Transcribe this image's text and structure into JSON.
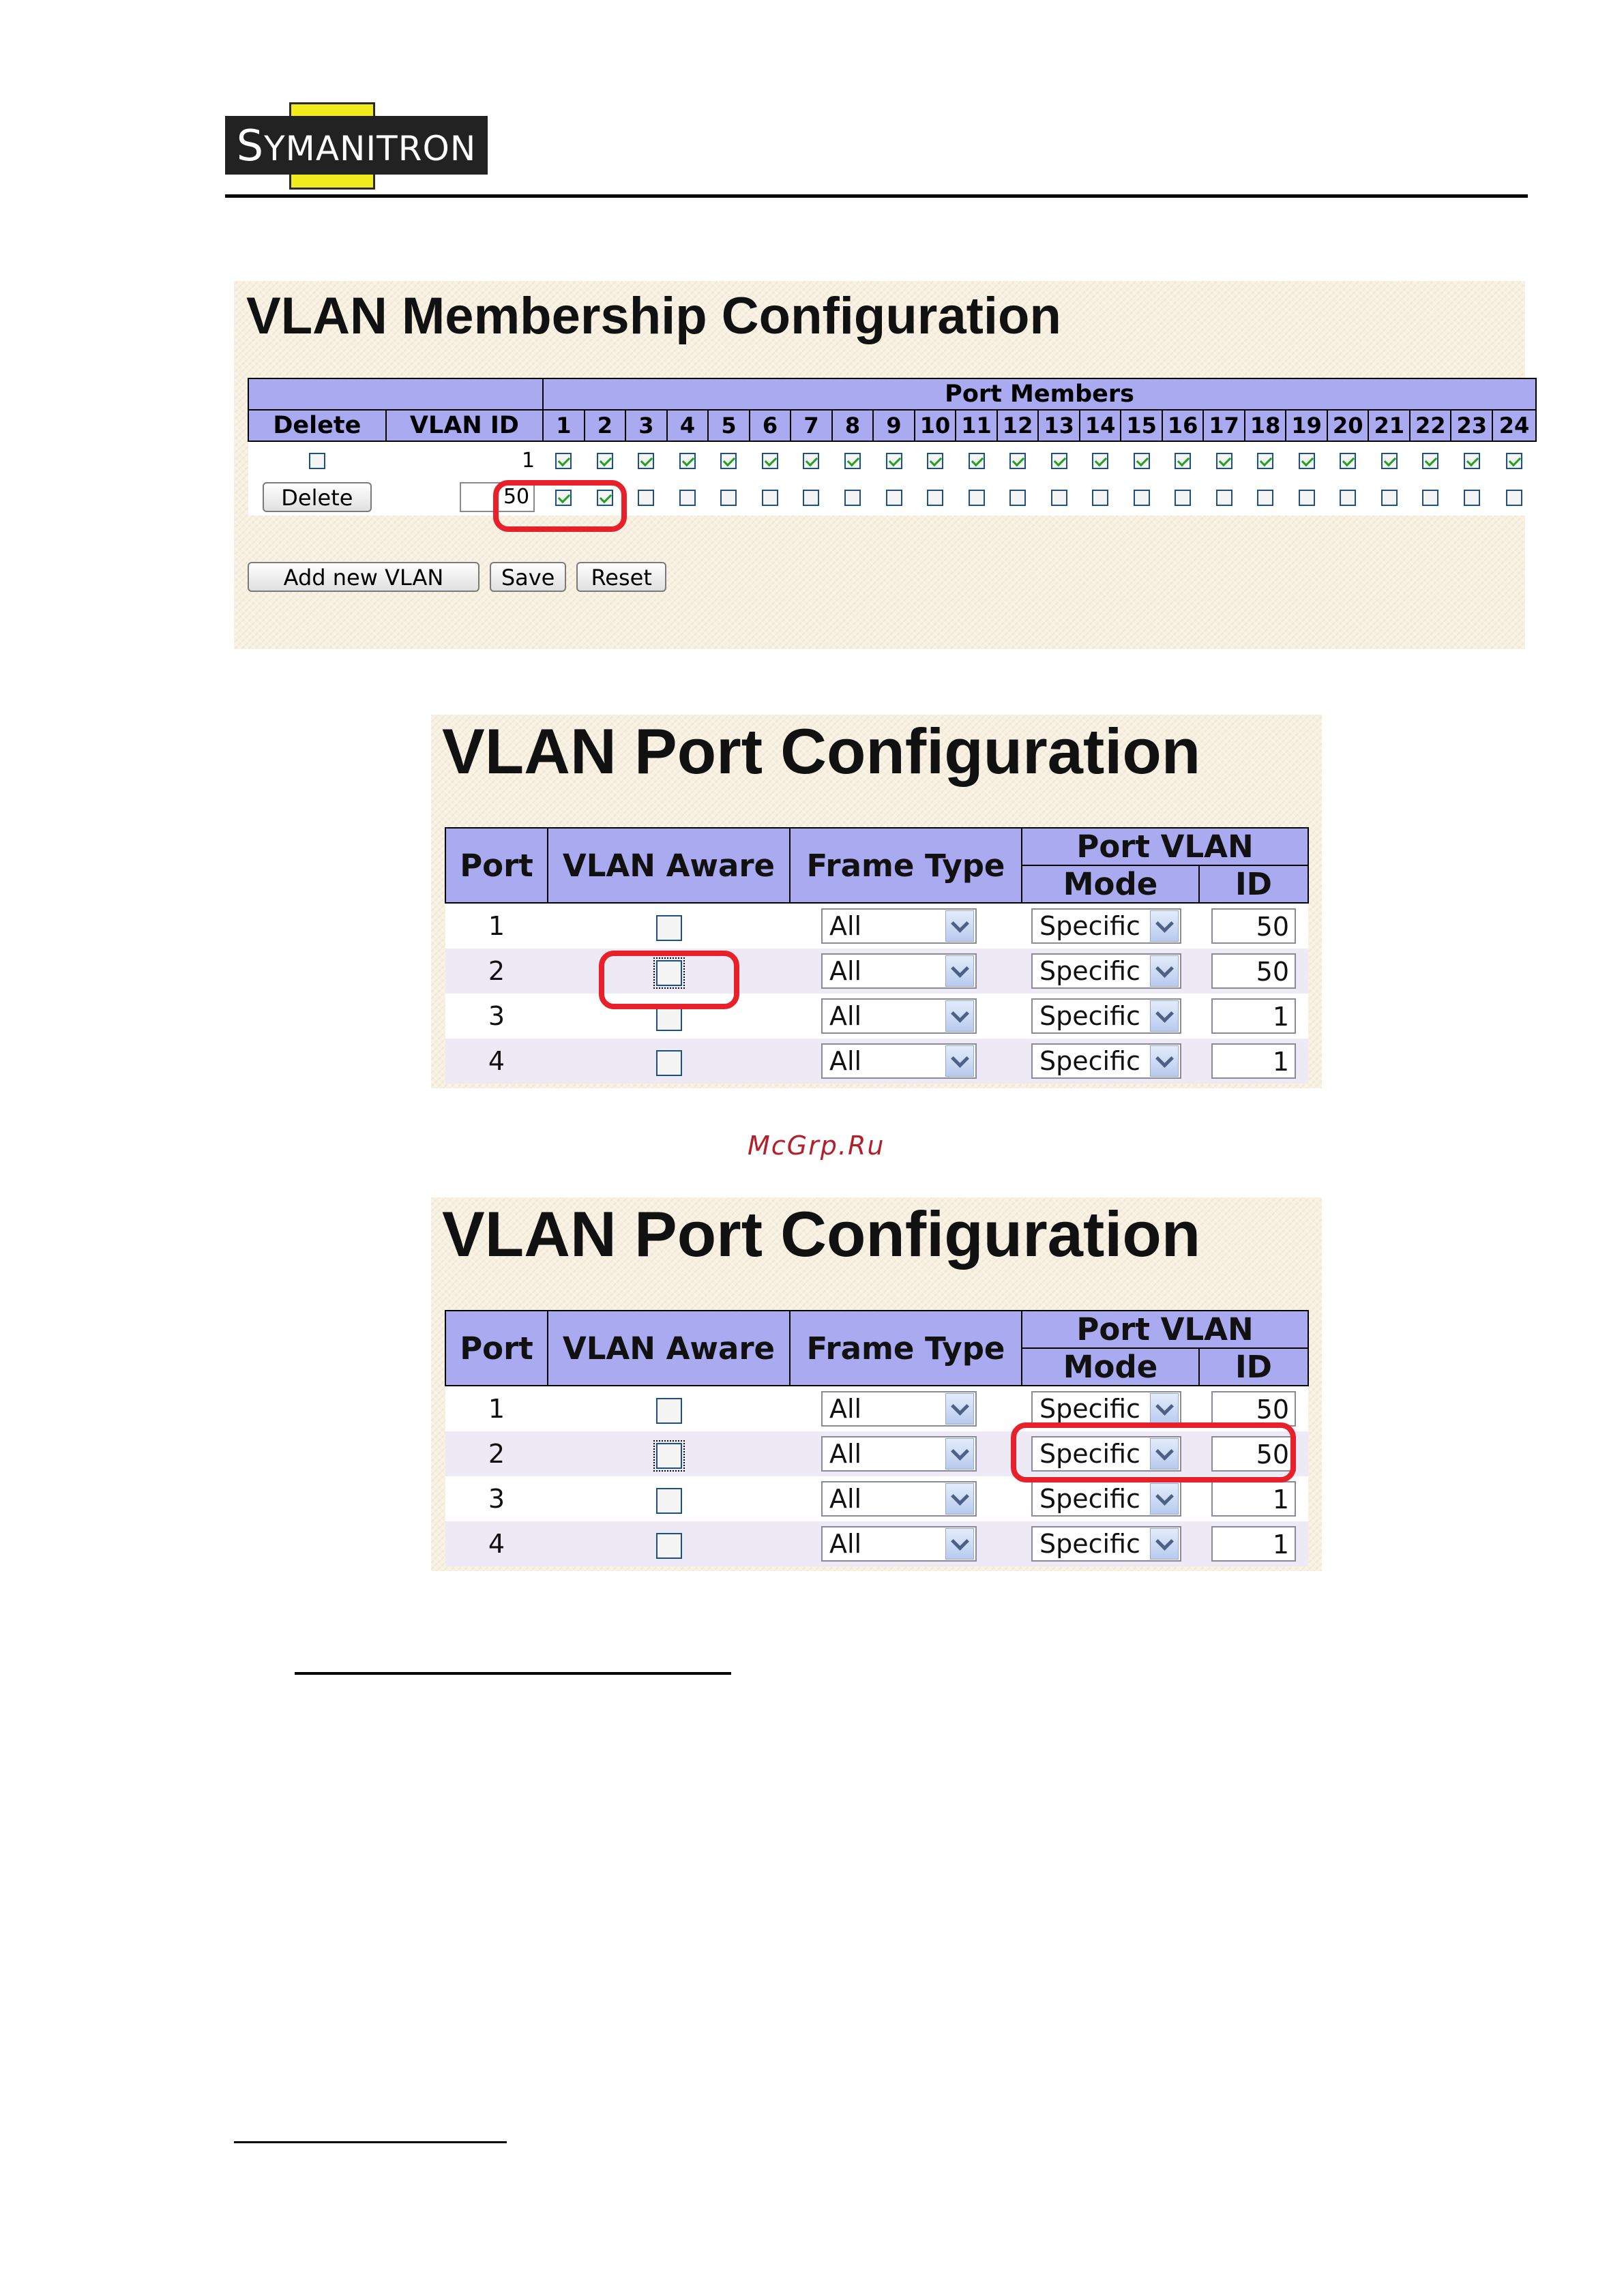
{
  "brand": {
    "logo_text": "SYMANITRON",
    "logo_initial": "S",
    "logo_rest": "YMANITRON"
  },
  "watermark": "McGrp.Ru",
  "membership": {
    "title": "VLAN Membership Configuration",
    "port_members_header": "Port Members",
    "delete_header": "Delete",
    "vlan_id_header": "VLAN ID",
    "ports": [
      "1",
      "2",
      "3",
      "4",
      "5",
      "6",
      "7",
      "8",
      "9",
      "10",
      "11",
      "12",
      "13",
      "14",
      "15",
      "16",
      "17",
      "18",
      "19",
      "20",
      "21",
      "22",
      "23",
      "24"
    ],
    "rows": [
      {
        "vlan_id": "1",
        "delete_type": "checkbox",
        "members": [
          true,
          true,
          true,
          true,
          true,
          true,
          true,
          true,
          true,
          true,
          true,
          true,
          true,
          true,
          true,
          true,
          true,
          true,
          true,
          true,
          true,
          true,
          true,
          true
        ]
      },
      {
        "vlan_id": "50",
        "delete_type": "button",
        "delete_label": "Delete",
        "members": [
          true,
          true,
          false,
          false,
          false,
          false,
          false,
          false,
          false,
          false,
          false,
          false,
          false,
          false,
          false,
          false,
          false,
          false,
          false,
          false,
          false,
          false,
          false,
          false
        ]
      }
    ],
    "buttons": {
      "add_new_vlan": "Add new VLAN",
      "save": "Save",
      "reset": "Reset"
    }
  },
  "port_config_1": {
    "title": "VLAN Port Configuration",
    "headers": {
      "port": "Port",
      "vlan_aware": "VLAN Aware",
      "frame_type": "Frame Type",
      "port_vlan": "Port VLAN",
      "mode": "Mode",
      "id": "ID"
    },
    "rows": [
      {
        "port": "1",
        "aware": false,
        "frame_type": "All",
        "mode": "Specific",
        "id": "50"
      },
      {
        "port": "2",
        "aware": false,
        "frame_type": "All",
        "mode": "Specific",
        "id": "50"
      },
      {
        "port": "3",
        "aware": false,
        "frame_type": "All",
        "mode": "Specific",
        "id": "1"
      },
      {
        "port": "4",
        "aware": false,
        "frame_type": "All",
        "mode": "Specific",
        "id": "1"
      }
    ]
  },
  "port_config_2": {
    "title": "VLAN Port Configuration",
    "headers": {
      "port": "Port",
      "vlan_aware": "VLAN Aware",
      "frame_type": "Frame Type",
      "port_vlan": "Port VLAN",
      "mode": "Mode",
      "id": "ID"
    },
    "rows": [
      {
        "port": "1",
        "aware": false,
        "frame_type": "All",
        "mode": "Specific",
        "id": "50"
      },
      {
        "port": "2",
        "aware": false,
        "frame_type": "All",
        "mode": "Specific",
        "id": "50"
      },
      {
        "port": "3",
        "aware": false,
        "frame_type": "All",
        "mode": "Specific",
        "id": "1"
      },
      {
        "port": "4",
        "aware": false,
        "frame_type": "All",
        "mode": "Specific",
        "id": "1"
      }
    ]
  },
  "colors": {
    "header_bg": "#aaaaf0",
    "highlight": "#e8202a",
    "panel_bg": "#f8f0e0",
    "check": "#21a121"
  }
}
